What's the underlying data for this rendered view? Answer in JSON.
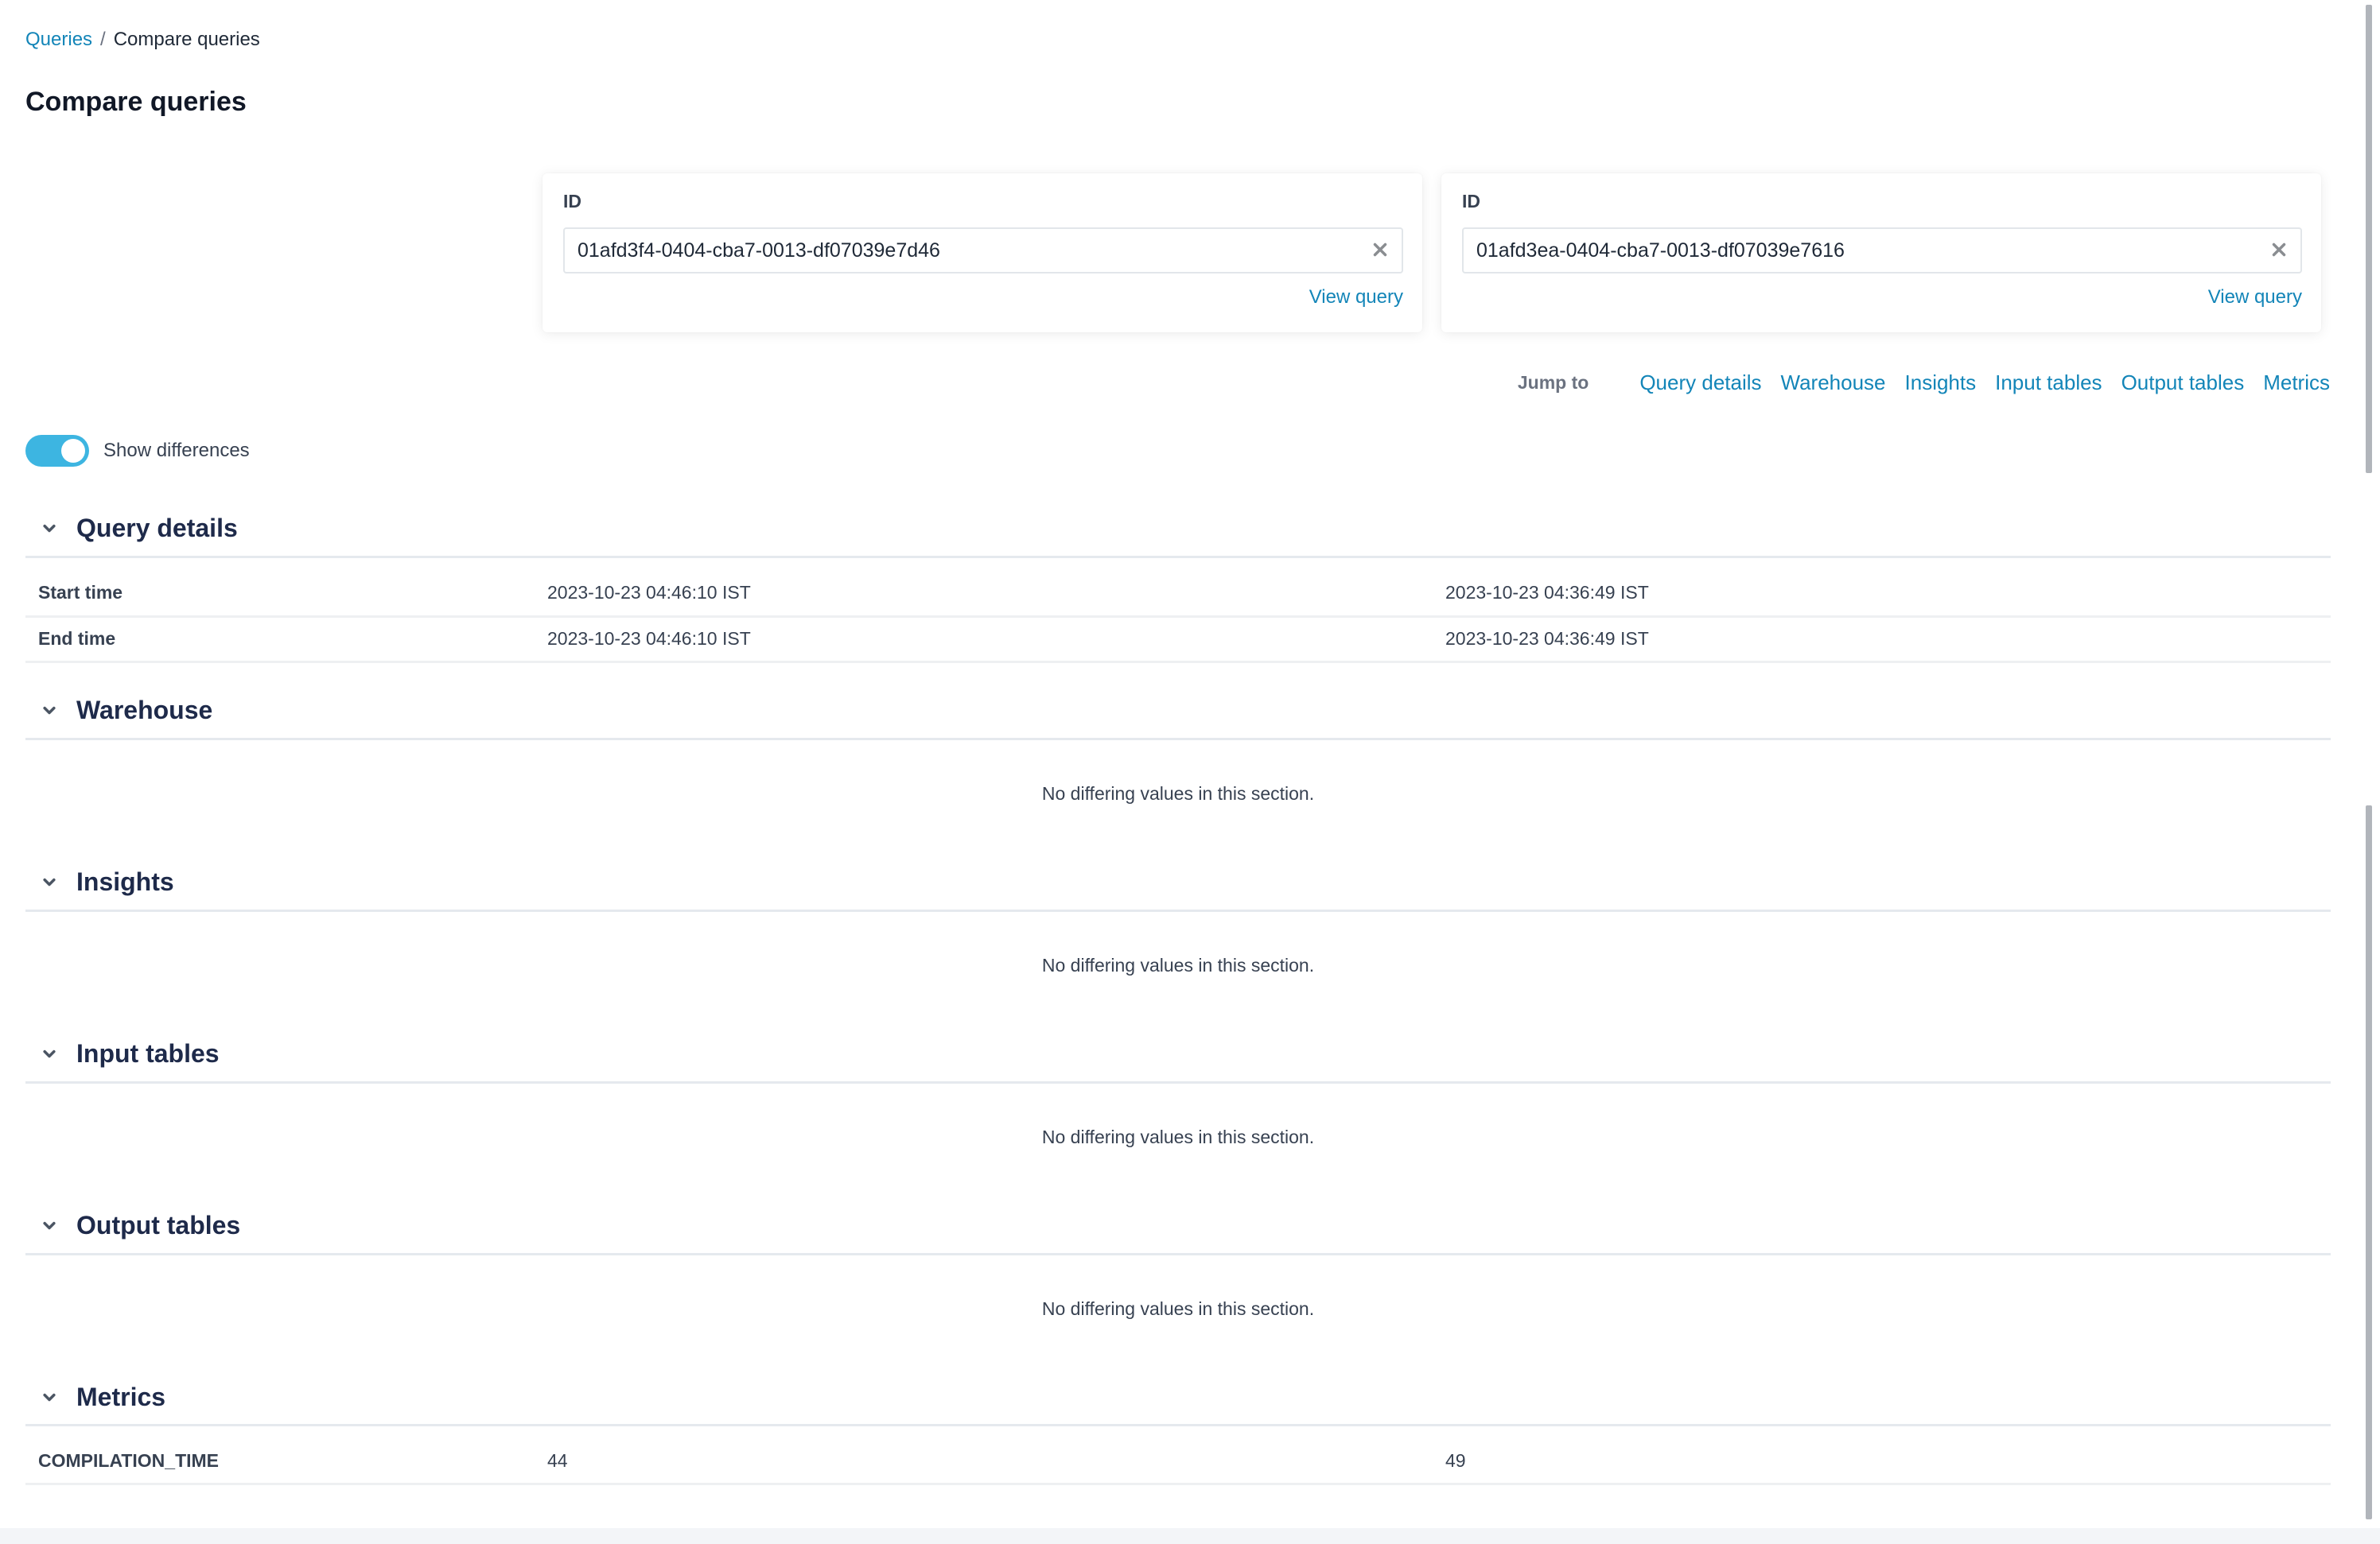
{
  "breadcrumb": {
    "parent": "Queries",
    "separator": "/",
    "current": "Compare queries"
  },
  "page_title": "Compare queries",
  "query_cards": [
    {
      "id_label": "ID",
      "id_value": "01afd3f4-0404-cba7-0013-df07039e7d46",
      "clear_icon": "close-icon",
      "view_query_label": "View query"
    },
    {
      "id_label": "ID",
      "id_value": "01afd3ea-0404-cba7-0013-df07039e7616",
      "clear_icon": "close-icon",
      "view_query_label": "View query"
    }
  ],
  "jump_to": {
    "label": "Jump to",
    "links": [
      "Query details",
      "Warehouse",
      "Insights",
      "Input tables",
      "Output tables",
      "Metrics"
    ]
  },
  "show_differences": {
    "label": "Show differences",
    "enabled": true
  },
  "sections": [
    {
      "title": "Query details",
      "expanded": true,
      "rows": [
        {
          "label": "Start time",
          "values": [
            "2023-10-23 04:46:10 IST",
            "2023-10-23 04:36:49 IST"
          ]
        },
        {
          "label": "End time",
          "values": [
            "2023-10-23 04:46:10 IST",
            "2023-10-23 04:36:49 IST"
          ]
        }
      ]
    },
    {
      "title": "Warehouse",
      "expanded": true,
      "empty_message": "No differing values in this section."
    },
    {
      "title": "Insights",
      "expanded": true,
      "empty_message": "No differing values in this section."
    },
    {
      "title": "Input tables",
      "expanded": true,
      "empty_message": "No differing values in this section."
    },
    {
      "title": "Output tables",
      "expanded": true,
      "empty_message": "No differing values in this section."
    },
    {
      "title": "Metrics",
      "expanded": true,
      "rows": [
        {
          "label": "COMPILATION_TIME",
          "values": [
            "44",
            "49"
          ]
        }
      ]
    }
  ],
  "colors": {
    "accent": "#1385b8",
    "toggle_on": "#3db5e1",
    "heading": "#1e2a4a",
    "text": "#374151"
  }
}
